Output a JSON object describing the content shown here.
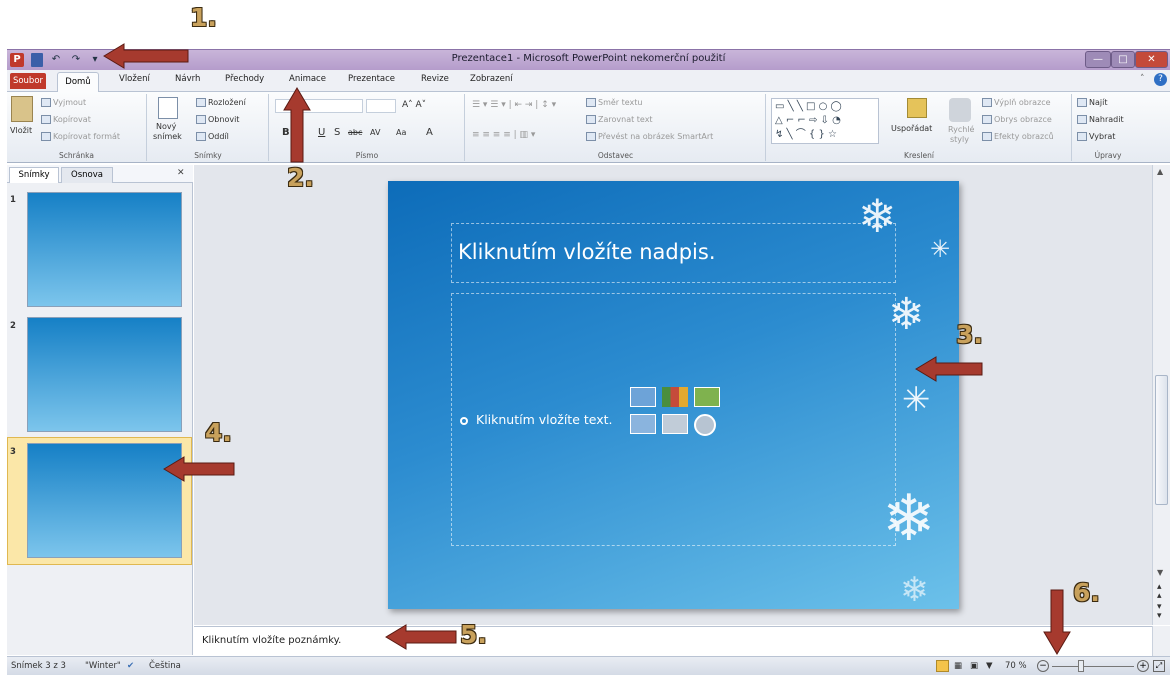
{
  "window": {
    "title": "Prezentace1 - Microsoft PowerPoint nekomerční použití",
    "app_icon": "P"
  },
  "quick_access": {
    "save_icon": "save-icon",
    "undo": "↶",
    "redo": "↷",
    "customize": "▾"
  },
  "tabs": [
    {
      "label": "Soubor"
    },
    {
      "label": "Domů"
    },
    {
      "label": "Vložení"
    },
    {
      "label": "Návrh"
    },
    {
      "label": "Přechody"
    },
    {
      "label": "Animace"
    },
    {
      "label": "Prezentace"
    },
    {
      "label": "Revize"
    },
    {
      "label": "Zobrazení"
    }
  ],
  "ribbon": {
    "clipboard": {
      "paste": "Vložit",
      "cut": "Vyjmout",
      "copy": "Kopírovat",
      "format": "Kopírovat formát",
      "label": "Schránka"
    },
    "slides": {
      "new": "Nový",
      "new2": "snímek",
      "layout": "Rozložení",
      "reset": "Obnovit",
      "section": "Oddíl",
      "label": "Snímky"
    },
    "font": {
      "bold": "B",
      "underline": "U",
      "strike": "S",
      "abc": "abc",
      "av": "AV",
      "aa": "Aa",
      "A": "A",
      "label": "Písmo"
    },
    "paragraph": {
      "dir": "Směr textu",
      "align": "Zarovnat text",
      "smartart": "Převést na obrázek SmartArt",
      "label": "Odstavec"
    },
    "drawing": {
      "arrange": "Uspořádat",
      "quick1": "Rychlé",
      "quick2": "styly",
      "fill": "Výplň obrazce",
      "outline": "Obrys obrazce",
      "effects": "Efekty obrazců",
      "label": "Kreslení"
    },
    "editing": {
      "find": "Najít",
      "replace": "Nahradit",
      "select": "Vybrat",
      "label": "Úpravy"
    }
  },
  "pane": {
    "tab1": "Snímky",
    "tab2": "Osnova",
    "close": "✕",
    "slides": [
      {
        "num": "1"
      },
      {
        "num": "2"
      },
      {
        "num": "3"
      }
    ]
  },
  "slide": {
    "title": "Kliknutím vložíte nadpis.",
    "bullet": "Kliknutím vložíte text."
  },
  "notes": {
    "placeholder": "Kliknutím vložíte poznámky."
  },
  "status": {
    "slide": "Snímek 3 z 3",
    "theme": "\"Winter\"",
    "language": "Čeština",
    "zoom": "70 %",
    "zoom_minus": "−",
    "zoom_plus": "+"
  },
  "annotations": [
    "1.",
    "2.",
    "3.",
    "4.",
    "5.",
    "6."
  ],
  "colors": {
    "accent": "#c0392b",
    "arrow": "#a63a2e",
    "number": "#c8a15c",
    "slide_bg": "#1a78c2"
  }
}
